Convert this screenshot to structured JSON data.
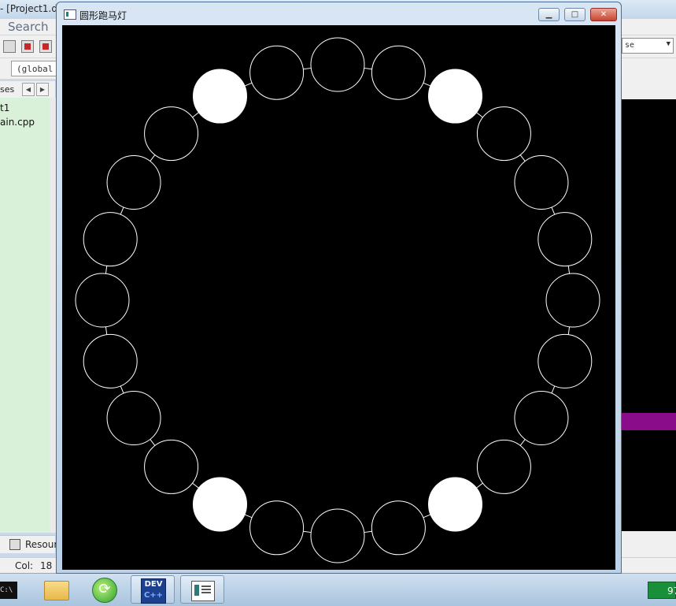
{
  "ide": {
    "title_fragment": "- [Project1.d",
    "menu_search": "Search",
    "global_combo": "(global",
    "config_select": "se",
    "project_tab_label": "ses",
    "project_items": [
      "t1",
      "ain.cpp"
    ],
    "resources_tab": "Resour",
    "status": {
      "col_label": "Col:",
      "col_value": "18"
    }
  },
  "window": {
    "title": "圆形跑马灯",
    "ring": {
      "count": 24,
      "lit_indices": [
        2,
        10,
        14,
        22
      ],
      "lit_color": "#ffffff",
      "unlit_fill": "#000000",
      "stroke_color": "#ffffff",
      "background": "#000000"
    }
  },
  "taskbar": {
    "cmd_label": "C:\\",
    "dev_label": "DEV",
    "dev_sub": "C++",
    "tray_text": "97"
  },
  "colors": {
    "console_strip": "#8a0c8a",
    "project_panel": "#d9f0d9",
    "tray_badge": "#1a8f3a"
  }
}
